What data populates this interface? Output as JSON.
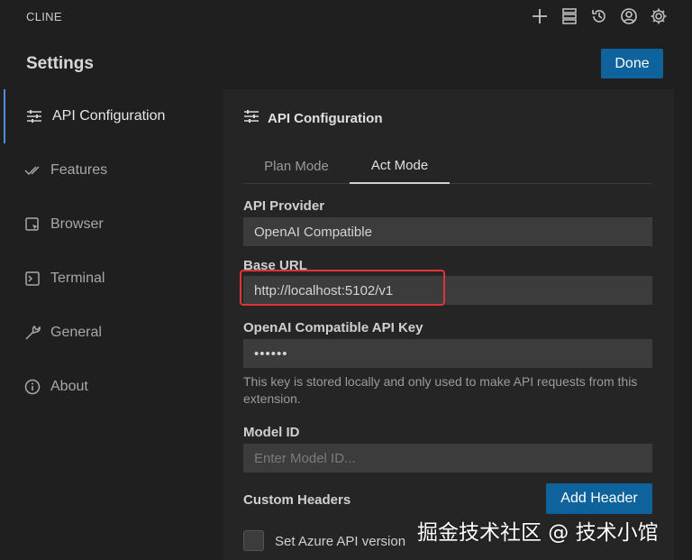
{
  "app": {
    "name": "CLINE"
  },
  "toolbar": {
    "icons": [
      "plus-icon",
      "server-icon",
      "history-icon",
      "account-icon",
      "gear-icon"
    ]
  },
  "header": {
    "title": "Settings",
    "done_label": "Done"
  },
  "sidebar": {
    "items": [
      {
        "label": "API Configuration",
        "icon": "sliders-icon",
        "active": true
      },
      {
        "label": "Features",
        "icon": "checks-icon",
        "active": false
      },
      {
        "label": "Browser",
        "icon": "browser-icon",
        "active": false
      },
      {
        "label": "Terminal",
        "icon": "terminal-icon",
        "active": false
      },
      {
        "label": "General",
        "icon": "wrench-icon",
        "active": false
      },
      {
        "label": "About",
        "icon": "info-icon",
        "active": false
      }
    ]
  },
  "main": {
    "section_title": "API Configuration",
    "tabs": [
      {
        "label": "Plan Mode",
        "active": false
      },
      {
        "label": "Act Mode",
        "active": true
      }
    ],
    "api_provider": {
      "label": "API Provider",
      "value": "OpenAI Compatible"
    },
    "base_url": {
      "label": "Base URL",
      "value": "http://localhost:5102/v1"
    },
    "api_key": {
      "label": "OpenAI Compatible API Key",
      "value": "••••••",
      "hint": "This key is stored locally and only used to make API requests from this extension."
    },
    "model_id": {
      "label": "Model ID",
      "placeholder": "Enter Model ID..."
    },
    "custom_headers": {
      "label": "Custom Headers",
      "add_label": "Add Header"
    },
    "azure": {
      "label": "Set Azure API version",
      "checked": false
    }
  },
  "watermark": {
    "text": "掘金技术社区 @ 技术小馆"
  },
  "colors": {
    "accent": "#0e639c",
    "highlight": "#e0343a",
    "active_nav_border": "#4d8fd8",
    "background": "#1f1f1f",
    "panel": "#252526",
    "input": "#3c3c3c"
  }
}
